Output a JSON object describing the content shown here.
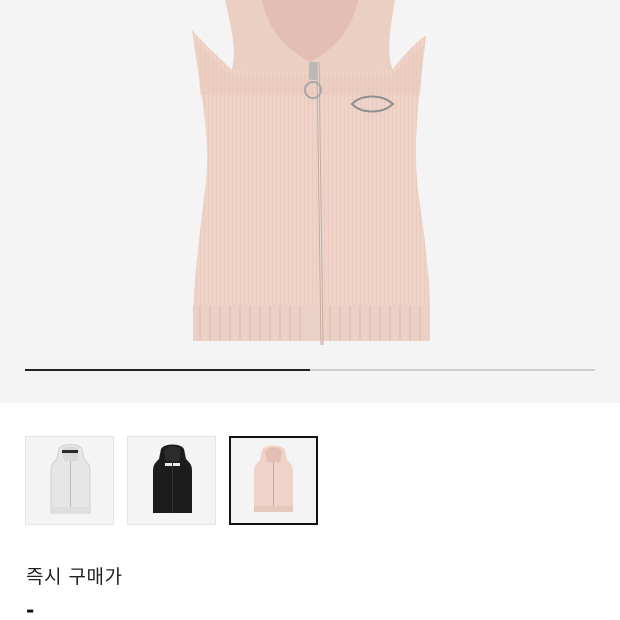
{
  "product": {
    "main_image": "pink-knit-hooded-zip-vest",
    "gallery_progress": 0.5
  },
  "thumbnails": [
    {
      "name": "white-knit-hooded-vest",
      "color": "#e9e9e9",
      "selected": false
    },
    {
      "name": "black-knit-hooded-vest",
      "color": "#1c1c1c",
      "selected": false
    },
    {
      "name": "pink-knit-hooded-vest",
      "color": "#efd3c8",
      "selected": true
    }
  ],
  "purchase": {
    "label": "즉시 구매가",
    "price": "-"
  },
  "colors": {
    "pink": "#efd3c8",
    "background": "#f4f4f4",
    "accent": "#222222"
  }
}
